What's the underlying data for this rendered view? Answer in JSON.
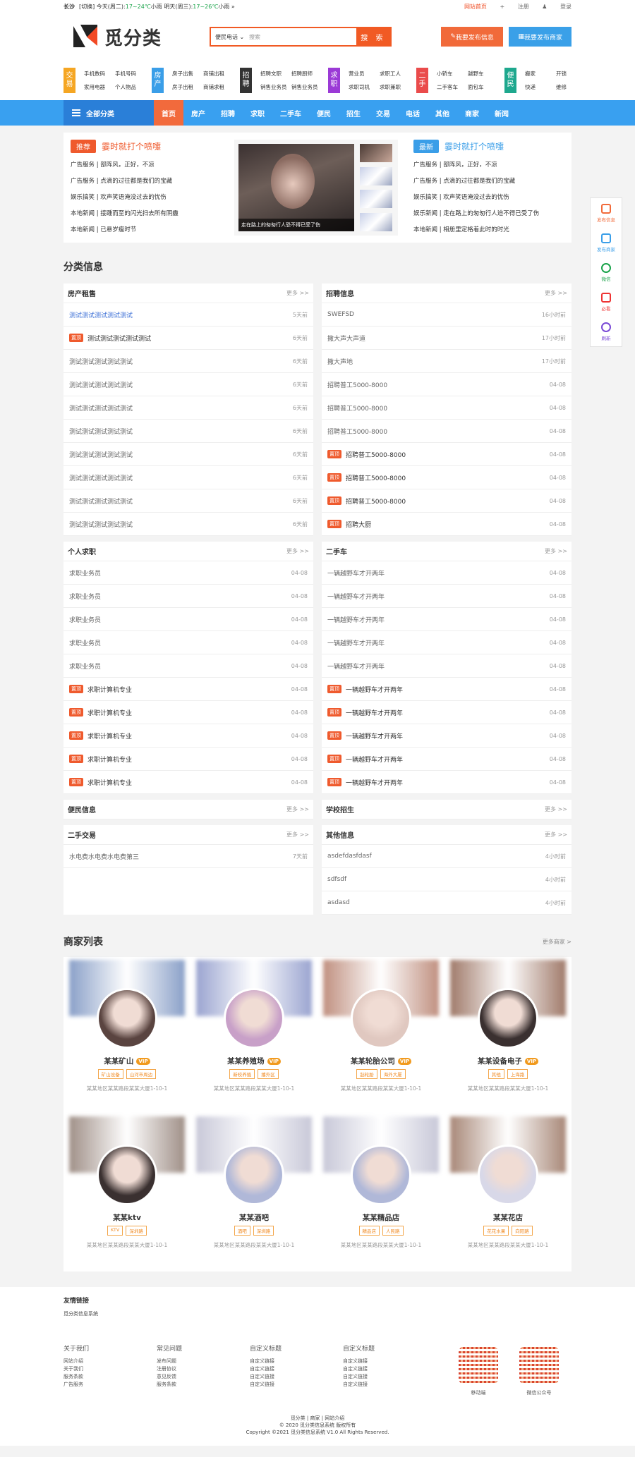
{
  "topbar": {
    "city": "长沙",
    "switch": "[切换]",
    "today_prefix": "今天(周二):",
    "today_temp": "17~24℃",
    "today_weather": "小雨",
    "tomorrow_prefix": "明天(周三):",
    "tomorrow_temp": "17~26℃",
    "tomorrow_weather": "小雨",
    "arrow": "»",
    "home": "网站首页",
    "register": "注册",
    "login": "登录"
  },
  "header": {
    "logo_text": "觅分类",
    "search_select": "便民电话",
    "search_placeholder": "搜索",
    "search_button": "搜 索",
    "btn_publish_info": "我要发布信息",
    "btn_publish_shop": "我要发布商家"
  },
  "categories": [
    {
      "tag": "交易",
      "color": "#f5a623",
      "items": [
        "手机数码",
        "手机号码",
        "家用电器",
        "个人物品"
      ]
    },
    {
      "tag": "房产",
      "color": "#3a9ee8",
      "items": [
        "房子出售",
        "商铺出租",
        "房子出租",
        "商铺求租"
      ]
    },
    {
      "tag": "招聘",
      "color": "#333333",
      "items": [
        "招聘文职",
        "招聘厨师",
        "销售业务员",
        "销售业务员"
      ]
    },
    {
      "tag": "求职",
      "color": "#9b3ad6",
      "items": [
        "营业员",
        "求职工人",
        "求职司机",
        "求职兼职"
      ]
    },
    {
      "tag": "二手",
      "color": "#ea4b4b",
      "items": [
        "小轿车",
        "越野车",
        "二手客车",
        "面包车"
      ]
    },
    {
      "tag": "便民",
      "color": "#1ea88e",
      "items": [
        "搬家",
        "开锁",
        "快递",
        "维修"
      ]
    }
  ],
  "nav": {
    "all": "全部分类",
    "items": [
      "首页",
      "房产",
      "招聘",
      "求职",
      "二手车",
      "便民",
      "招生",
      "交易",
      "电话",
      "其他",
      "商家",
      "新闻"
    ]
  },
  "hot": {
    "left": {
      "badge": "推荐",
      "badge_color": "#ef5a2d",
      "title": "霎时就打个喷嚏",
      "items": [
        "广告服务 | 部阵风，正好，不凉",
        "广告服务 | 点滴的过往都是我们的宝藏",
        "娱乐搞笑 | 欢声笑语淹没过去的忧伤",
        "本地新闻 | 接踵而至的闪光扫去所有阴霾",
        "本地新闻 | 已悬岁瘦时节"
      ]
    },
    "slide_caption": "走在路上的匆匆行人恐不得已受了伤",
    "right": {
      "badge": "最新",
      "badge_color": "#3a9ee8",
      "title": "霎时就打个喷嚏",
      "items": [
        "广告服务 | 部阵风，正好，不凉",
        "广告服务 | 点滴的过往都是我们的宝藏",
        "娱乐搞笑 | 欢声笑语淹没过去的忧伤",
        "娱乐新闻 | 走在路上的匆匆行人迫不得已受了伤",
        "本地新闻 | 相册里定格着此时的时光"
      ]
    }
  },
  "section_title": "分类信息",
  "more": "更多 >>",
  "top_badge": "置顶",
  "panels": [
    {
      "title": "房产租售",
      "rows": [
        {
          "t": "测试测试测试测试测试",
          "d": "5天前",
          "top": false,
          "link": true
        },
        {
          "t": "测试测试测试测试测试",
          "d": "6天前",
          "top": true
        },
        {
          "t": "测试测试测试测试测试",
          "d": "6天前",
          "top": false
        },
        {
          "t": "测试测试测试测试测试",
          "d": "6天前",
          "top": false
        },
        {
          "t": "测试测试测试测试测试",
          "d": "6天前",
          "top": false
        },
        {
          "t": "测试测试测试测试测试",
          "d": "6天前",
          "top": false
        },
        {
          "t": "测试测试测试测试测试",
          "d": "6天前",
          "top": false
        },
        {
          "t": "测试测试测试测试测试",
          "d": "6天前",
          "top": false
        },
        {
          "t": "测试测试测试测试测试",
          "d": "6天前",
          "top": false
        },
        {
          "t": "测试测试测试测试测试",
          "d": "6天前",
          "top": false
        }
      ]
    },
    {
      "title": "招聘信息",
      "rows": [
        {
          "t": "SWEFSD",
          "d": "16小时前",
          "top": false
        },
        {
          "t": "撒大声大声道",
          "d": "17小时前",
          "top": false
        },
        {
          "t": "撒大声地",
          "d": "17小时前",
          "top": false
        },
        {
          "t": "招聘普工5000-8000",
          "d": "04-08",
          "top": false
        },
        {
          "t": "招聘普工5000-8000",
          "d": "04-08",
          "top": false
        },
        {
          "t": "招聘普工5000-8000",
          "d": "04-08",
          "top": false
        },
        {
          "t": "招聘普工5000-8000",
          "d": "04-08",
          "top": true
        },
        {
          "t": "招聘普工5000-8000",
          "d": "04-08",
          "top": true
        },
        {
          "t": "招聘普工5000-8000",
          "d": "04-08",
          "top": true
        },
        {
          "t": "招聘大厨",
          "d": "04-08",
          "top": true
        }
      ]
    },
    {
      "title": "个人求职",
      "rows": [
        {
          "t": "求职业务员",
          "d": "04-08",
          "top": false
        },
        {
          "t": "求职业务员",
          "d": "04-08",
          "top": false
        },
        {
          "t": "求职业务员",
          "d": "04-08",
          "top": false
        },
        {
          "t": "求职业务员",
          "d": "04-08",
          "top": false
        },
        {
          "t": "求职业务员",
          "d": "04-08",
          "top": false
        },
        {
          "t": "求职计算机专业",
          "d": "04-08",
          "top": true
        },
        {
          "t": "求职计算机专业",
          "d": "04-08",
          "top": true
        },
        {
          "t": "求职计算机专业",
          "d": "04-08",
          "top": true
        },
        {
          "t": "求职计算机专业",
          "d": "04-08",
          "top": true
        },
        {
          "t": "求职计算机专业",
          "d": "04-08",
          "top": true
        }
      ]
    },
    {
      "title": "二手车",
      "rows": [
        {
          "t": "一辆越野车才开两年",
          "d": "04-08",
          "top": false
        },
        {
          "t": "一辆越野车才开两年",
          "d": "04-08",
          "top": false
        },
        {
          "t": "一辆越野车才开两年",
          "d": "04-08",
          "top": false
        },
        {
          "t": "一辆越野车才开两年",
          "d": "04-08",
          "top": false
        },
        {
          "t": "一辆越野车才开两年",
          "d": "04-08",
          "top": false
        },
        {
          "t": "一辆越野车才开两年",
          "d": "04-08",
          "top": true
        },
        {
          "t": "一辆越野车才开两年",
          "d": "04-08",
          "top": true
        },
        {
          "t": "一辆越野车才开两年",
          "d": "04-08",
          "top": true
        },
        {
          "t": "一辆越野车才开两年",
          "d": "04-08",
          "top": true
        },
        {
          "t": "一辆越野车才开两年",
          "d": "04-08",
          "top": true
        }
      ]
    },
    {
      "title": "便民信息",
      "rows": []
    },
    {
      "title": "学校招生",
      "rows": []
    },
    {
      "title": "二手交易",
      "rows": [
        {
          "t": "水电费水电费水电费第三",
          "d": "7天前",
          "top": false
        }
      ]
    },
    {
      "title": "其他信息",
      "rows": [
        {
          "t": "asdefdasfdasf",
          "d": "4小时前",
          "top": false
        },
        {
          "t": "sdfsdf",
          "d": "4小时前",
          "top": false
        },
        {
          "t": "asdasd",
          "d": "4小时前",
          "top": false
        }
      ]
    }
  ],
  "merchants": {
    "title": "商家列表",
    "more": "更多商家 >",
    "vip": "VIP",
    "addr": "某某地区某某路段某某大厦1-10-1",
    "items": [
      {
        "name": "某某矿山",
        "vip": true,
        "tags": [
          "矿山设备",
          "山河市周边"
        ],
        "bg": "#8aa0c8",
        "av": "#5a4440"
      },
      {
        "name": "某某养殖场",
        "vip": true,
        "tags": [
          "新校养殖",
          "播外区"
        ],
        "bg": "#9aa4d0",
        "av": "#c8a0c8"
      },
      {
        "name": "某某轮胎公司",
        "vip": true,
        "tags": [
          "起轮胎",
          "海外大厦"
        ],
        "bg": "#c09080",
        "av": "#e0c8c0"
      },
      {
        "name": "某某设备电子",
        "vip": true,
        "tags": [
          "其他",
          "上海路"
        ],
        "bg": "#a07a6a",
        "av": "#3a3030"
      },
      {
        "name": "某某ktv",
        "vip": false,
        "tags": [
          "KTV",
          "深圳路"
        ],
        "bg": "#a09088",
        "av": "#3a3030"
      },
      {
        "name": "某某酒吧",
        "vip": false,
        "tags": [
          "酒吧",
          "深圳路"
        ],
        "bg": "#c8c8d8",
        "av": "#b0b8d8"
      },
      {
        "name": "某某精品店",
        "vip": false,
        "tags": [
          "精品店",
          "人民路"
        ],
        "bg": "#c8c8d8",
        "av": "#b0b8d8"
      },
      {
        "name": "某某花店",
        "vip": false,
        "tags": [
          "花花水果",
          "向阳路"
        ],
        "bg": "#a88878",
        "av": "#d8d8e8"
      }
    ]
  },
  "footer": {
    "links_title": "友情链接",
    "links": "觅分类信息系统",
    "cols": [
      {
        "h": "关于我们",
        "items": [
          "网站介绍",
          "关于我们",
          "服务条款",
          "广告服务"
        ]
      },
      {
        "h": "常见问题",
        "items": [
          "发布问题",
          "注册协议",
          "意见反馈",
          "服务条款"
        ]
      },
      {
        "h": "自定义标题",
        "items": [
          "自定义链接",
          "自定义链接",
          "自定义链接",
          "自定义链接"
        ]
      },
      {
        "h": "自定义标题",
        "items": [
          "自定义链接",
          "自定义链接",
          "自定义链接",
          "自定义链接"
        ]
      }
    ],
    "qr1": "移动端",
    "qr2": "微信公众号",
    "copy1": "觅分类 | 商家 | 网站介绍",
    "copy2": "© 2020 觅分类信息系统 版权所有",
    "copy3": "Copyright ©2021 觅分类信息系统 V1.0 All Rights Reserved."
  },
  "sidebar": [
    {
      "label": "发布信息",
      "color": "#f16a3a"
    },
    {
      "label": "发布商家",
      "color": "#3a9ee8"
    },
    {
      "label": "微信",
      "color": "#1aa34a"
    },
    {
      "label": "必看",
      "color": "#e33"
    },
    {
      "label": "刷新",
      "color": "#7a4ad6"
    }
  ]
}
